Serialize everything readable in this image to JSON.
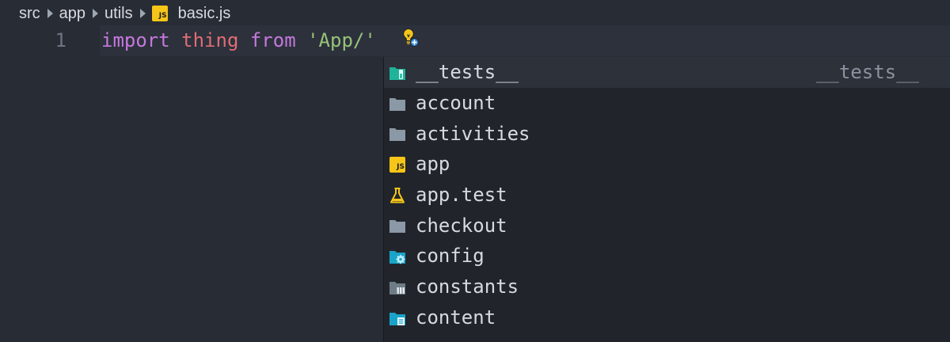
{
  "breadcrumb": {
    "items": [
      "src",
      "app",
      "utils"
    ],
    "file_icon_text": "JS",
    "file_name": "basic.js"
  },
  "editor": {
    "line_number": "1",
    "tokens": {
      "keyword_import": "import",
      "identifier": "thing",
      "keyword_from": "from",
      "string": "'App/'"
    },
    "colors": {
      "keyword": "#c678dd",
      "identifier": "#e06c75",
      "string": "#98c379",
      "background": "#282c34"
    }
  },
  "suggestions": {
    "items": [
      {
        "label": "__tests__",
        "detail": "__tests__",
        "icon": "test-folder-icon",
        "selected": true
      },
      {
        "label": "account",
        "icon": "folder-icon"
      },
      {
        "label": "activities",
        "icon": "folder-icon"
      },
      {
        "label": "app",
        "icon": "js-file-icon",
        "icon_text": "JS"
      },
      {
        "label": "app.test",
        "icon": "flask-icon"
      },
      {
        "label": "checkout",
        "icon": "folder-icon"
      },
      {
        "label": "config",
        "icon": "config-folder-icon"
      },
      {
        "label": "constants",
        "icon": "constants-folder-icon"
      },
      {
        "label": "content",
        "icon": "content-folder-icon"
      }
    ]
  }
}
